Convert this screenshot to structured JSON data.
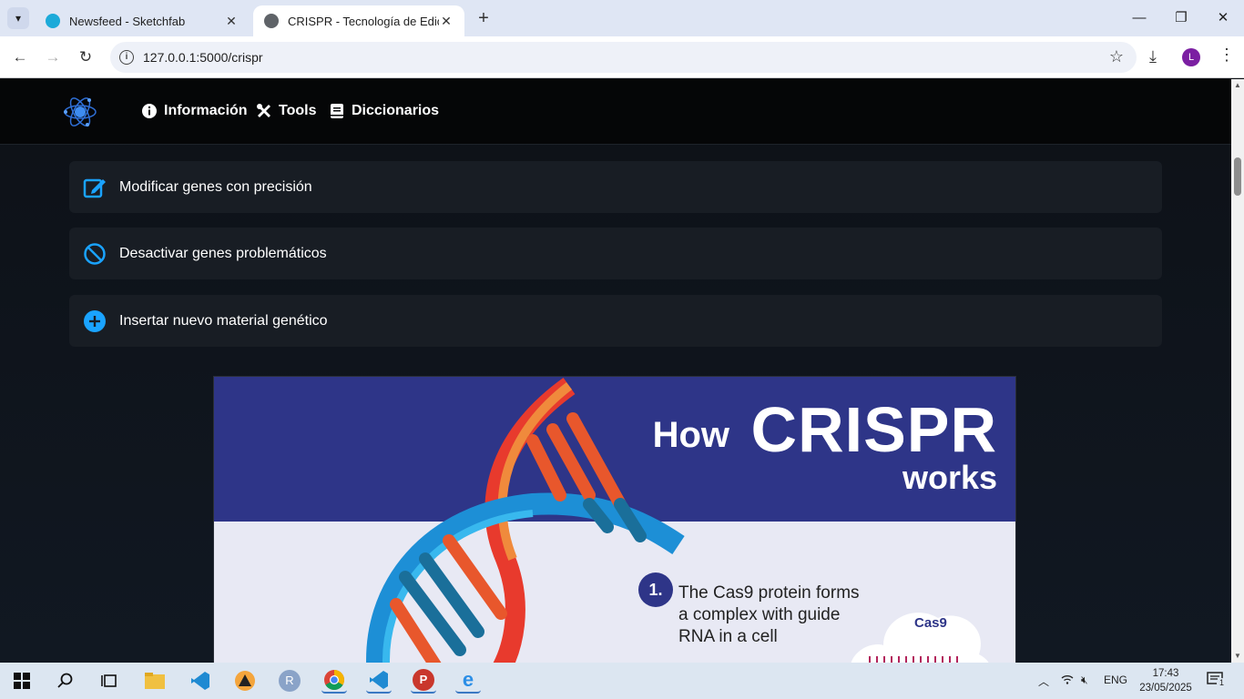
{
  "browser": {
    "tabs": [
      {
        "title": "Newsfeed - Sketchfab",
        "active": false,
        "favicon": "sketchfab-icon"
      },
      {
        "title": "CRISPR - Tecnología de Edición",
        "active": true,
        "favicon": "globe-icon"
      }
    ],
    "url": "127.0.0.1:5000/crispr",
    "profile_initial": "L"
  },
  "site_nav": {
    "links": [
      {
        "label": "Información",
        "icon": "info-circle-icon"
      },
      {
        "label": "Tools",
        "icon": "tools-icon"
      },
      {
        "label": "Diccionarios",
        "icon": "book-icon"
      }
    ]
  },
  "features": [
    {
      "label": "Modificar genes con precisión",
      "icon": "edit-icon"
    },
    {
      "label": "Desactivar genes problemáticos",
      "icon": "ban-icon"
    },
    {
      "label": "Insertar nuevo material genético",
      "icon": "plus-circle-icon"
    }
  ],
  "infographic": {
    "how": "How",
    "crispr": "CRISPR",
    "works": "works",
    "step_number": "1.",
    "step_text": "The Cas9 protein forms a complex with guide RNA in a cell",
    "cas9_label": "Cas9"
  },
  "taskbar": {
    "language": "ENG",
    "time": "17:43",
    "date": "23/05/2025",
    "notification_count": "1"
  },
  "colors": {
    "accent_blue": "#1aa3ff",
    "nav_bg": "#050607",
    "page_bg": "#0d1117",
    "card_bg": "#181d24",
    "infographic_banner": "#2e3588"
  }
}
